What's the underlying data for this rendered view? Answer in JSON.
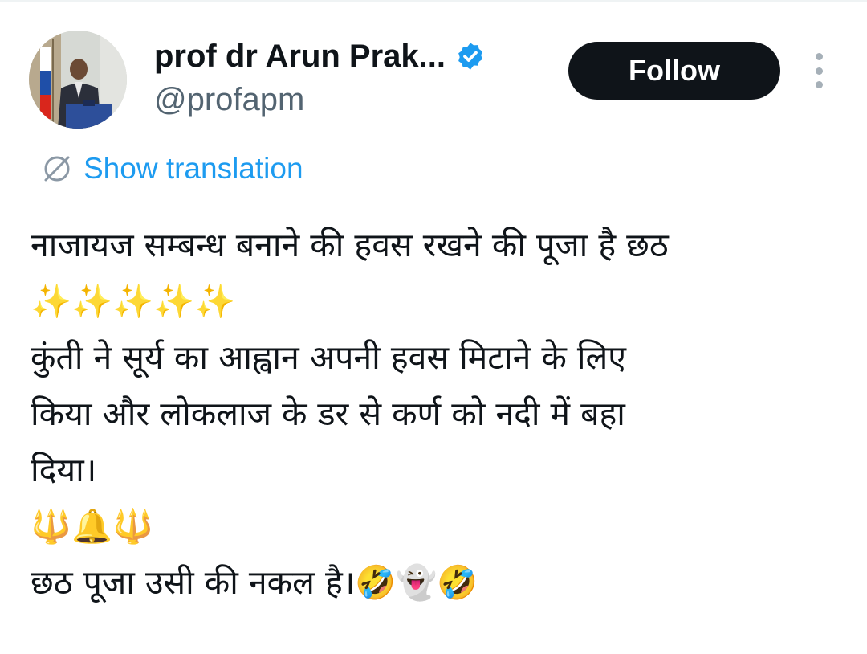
{
  "author": {
    "display_name": "prof dr Arun Prak...",
    "handle": "@profapm",
    "verified": true
  },
  "actions": {
    "follow_label": "Follow",
    "more_icon": "more-vertical-icon"
  },
  "translation": {
    "label": "Show translation",
    "icon": "translate-globe-icon"
  },
  "tweet": {
    "lines": [
      "नाजायज सम्बन्ध बनाने की हवस रखने की पूजा है छठ",
      "✨✨✨✨✨",
      "कुंती ने सूर्य का आह्वान अपनी हवस मिटाने के लिए",
      "किया और लोकलाज के डर से कर्ण को नदी में बहा",
      "दिया।",
      "🔱🔔🔱",
      "छठ पूजा उसी की नकल है।🤣👻🤣"
    ]
  },
  "colors": {
    "text_primary": "#0f1419",
    "text_secondary": "#536471",
    "accent": "#1d9bf0",
    "follow_bg": "#0f1419",
    "verified_badge": "#1d9bf0"
  }
}
